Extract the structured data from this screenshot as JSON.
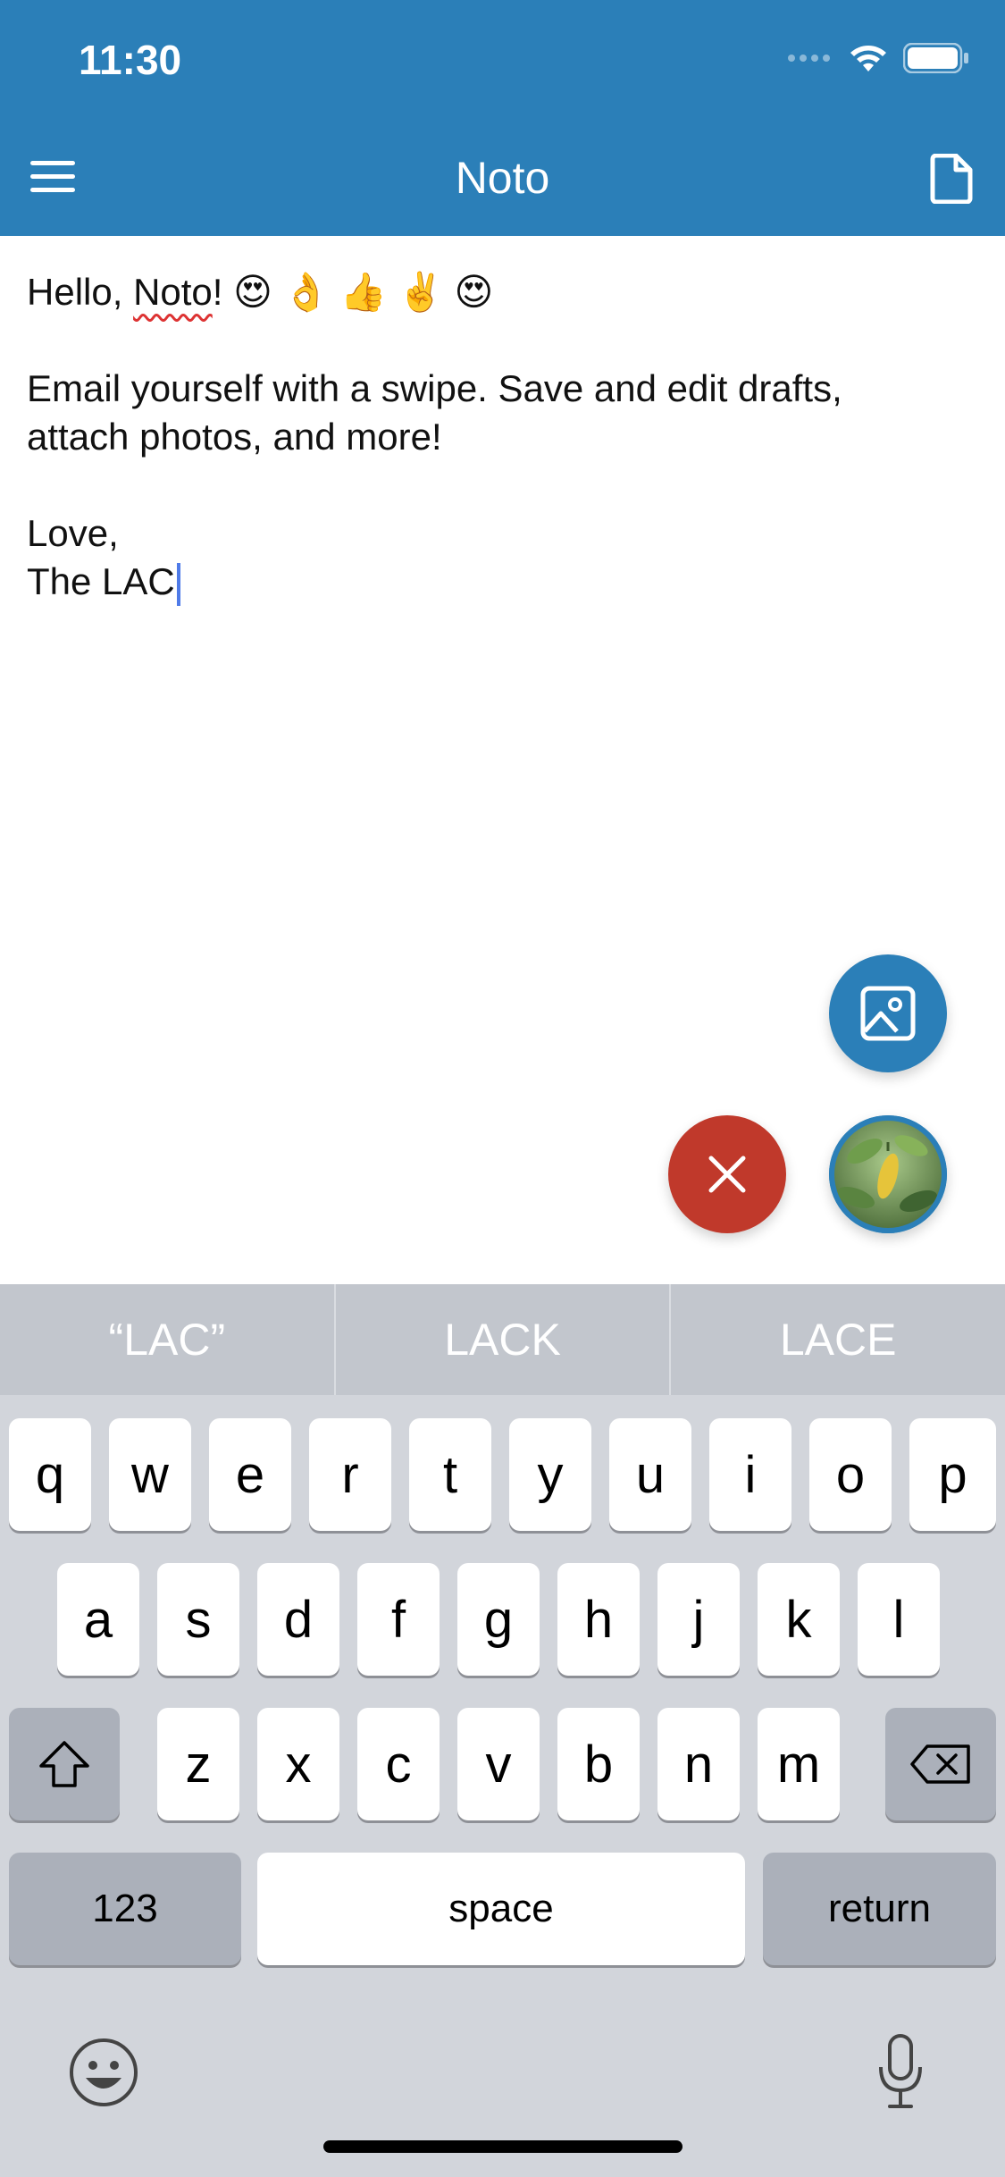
{
  "status_bar": {
    "time": "11:30"
  },
  "nav": {
    "title": "Noto",
    "menu_icon": "hamburger-icon",
    "new_icon": "new-document-icon"
  },
  "editor": {
    "line1_text": "Hello, ",
    "line1_misspelled": "Noto",
    "line1_rest": "! 😍 👌 👍 ✌️ 😍",
    "line2": "",
    "line3": "Email yourself with a swipe. Save and edit drafts,",
    "line4": "attach photos, and more!",
    "line5": "",
    "line6": "Love,",
    "line7": "The LAC"
  },
  "actions": {
    "attach_image_icon": "image-icon",
    "cancel_icon": "close-icon",
    "thumbnail": "attached-photo-thumbnail"
  },
  "keyboard": {
    "suggestions": [
      "“LAC”",
      "LACK",
      "LACE"
    ],
    "row1": [
      "q",
      "w",
      "e",
      "r",
      "t",
      "y",
      "u",
      "i",
      "o",
      "p"
    ],
    "row2": [
      "a",
      "s",
      "d",
      "f",
      "g",
      "h",
      "j",
      "k",
      "l"
    ],
    "row3": [
      "z",
      "x",
      "c",
      "v",
      "b",
      "n",
      "m"
    ],
    "numbers_label": "123",
    "space_label": "space",
    "return_label": "return"
  },
  "colors": {
    "brand": "#2b7fb8",
    "cancel": "#c0392b",
    "cursor": "#4f7be8"
  }
}
